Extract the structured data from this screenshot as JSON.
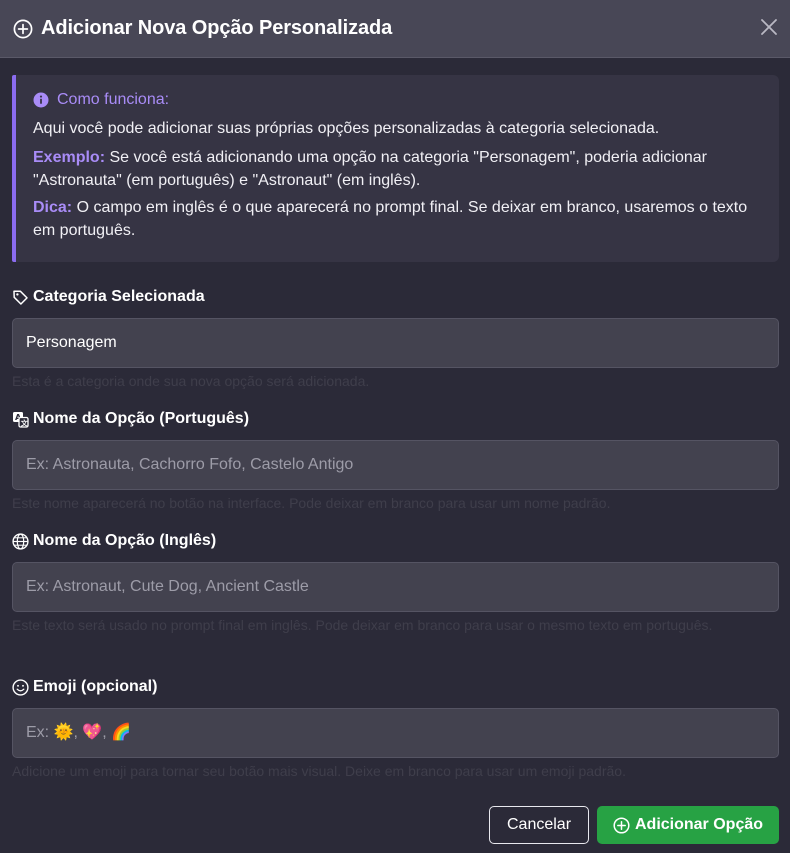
{
  "modal": {
    "title": "Adicionar Nova Opção Personalizada",
    "title_icon": "plus-circle-icon",
    "close_icon": "close-icon"
  },
  "info": {
    "icon": "info-circle-icon",
    "title": "Como funciona:",
    "intro": "Aqui você pode adicionar suas próprias opções personalizadas à categoria selecionada.",
    "example_label": "Exemplo:",
    "example_text": " Se você está adicionando uma opção na categoria \"Personagem\", poderia adicionar \"Astronauta\" (em português) e \"Astronaut\" (em inglês).",
    "tip_label": "Dica:",
    "tip_text": " O campo em inglês é o que aparecerá no prompt final. Se deixar em branco, usaremos o texto em português."
  },
  "fields": {
    "category": {
      "icon": "tag-icon",
      "label": "Categoria Selecionada",
      "value": "Personagem",
      "help": "Esta é a categoria onde sua nova opção será adicionada."
    },
    "name_pt": {
      "icon": "translate-icon",
      "label": "Nome da Opção (Português)",
      "value": "",
      "placeholder": "Ex: Astronauta, Cachorro Fofo, Castelo Antigo",
      "help": "Este nome aparecerá no botão na interface. Pode deixar em branco para usar um nome padrão."
    },
    "name_en": {
      "icon": "globe-icon",
      "label": "Nome da Opção (Inglês)",
      "value": "",
      "placeholder": "Ex: Astronaut, Cute Dog, Ancient Castle",
      "help": "Este texto será usado no prompt final em inglês. Pode deixar em branco para usar o mesmo texto em português."
    },
    "emoji": {
      "icon": "smiley-icon",
      "label": "Emoji (opcional)",
      "value": "",
      "placeholder": "Ex: 🌞, 💖, 🌈",
      "help": "Adicione um emoji para tornar seu botão mais visual. Deixe em branco para usar um emoji padrão."
    }
  },
  "actions": {
    "cancel_label": "Cancelar",
    "add_label": "Adicionar Opção",
    "add_icon": "plus-circle-icon"
  },
  "colors": {
    "background": "#2b2a38",
    "header": "#484756",
    "accent": "#a98cf7",
    "accent_border": "#8b6cf0",
    "success": "#27a244",
    "input_bg": "#43424f"
  }
}
